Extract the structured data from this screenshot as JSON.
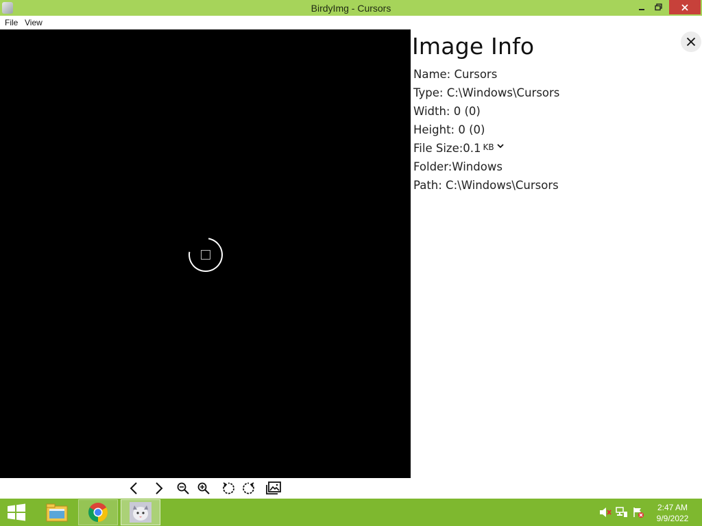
{
  "window": {
    "title": "BirdyImg - Cursors",
    "minimize_icon": "minimize-icon",
    "restore_icon": "restore-icon",
    "close_icon": "close-icon"
  },
  "menu": {
    "file": "File",
    "view": "View"
  },
  "viewer": {
    "state": "loading",
    "background_color": "#000000"
  },
  "toolbar": {
    "buttons": [
      {
        "name": "previous",
        "icon": "chevron-left-icon"
      },
      {
        "name": "next",
        "icon": "chevron-right-icon"
      },
      {
        "name": "zoom-out",
        "icon": "zoom-out-icon"
      },
      {
        "name": "zoom-in",
        "icon": "zoom-in-icon"
      },
      {
        "name": "rotate-left",
        "icon": "rotate-left-icon"
      },
      {
        "name": "rotate-right",
        "icon": "rotate-right-icon"
      },
      {
        "name": "gallery",
        "icon": "gallery-icon"
      }
    ]
  },
  "info": {
    "title": "Image Info",
    "close_icon": "close-icon",
    "name": "Name: Cursors",
    "type": "Type: C:\\Windows\\Cursors",
    "width": "Width: 0 (0)",
    "height": "Height: 0 (0)",
    "file_size_label": "File Size:",
    "file_size_value": "0.1",
    "file_size_unit": "KB",
    "folder": "Folder:Windows",
    "path": "Path: C:\\Windows\\Cursors"
  },
  "taskbar": {
    "apps": [
      "windows-start-icon",
      "file-explorer-icon",
      "chrome-icon",
      "birdyimg-icon"
    ],
    "tray": [
      "volume-muted-icon",
      "network-icon",
      "action-center-icon"
    ],
    "time": "2:47 AM",
    "date": "9/9/2022"
  },
  "colors": {
    "titlebar": "#a6d45a",
    "taskbar": "#7eb82f",
    "close_button": "#c7413a"
  }
}
